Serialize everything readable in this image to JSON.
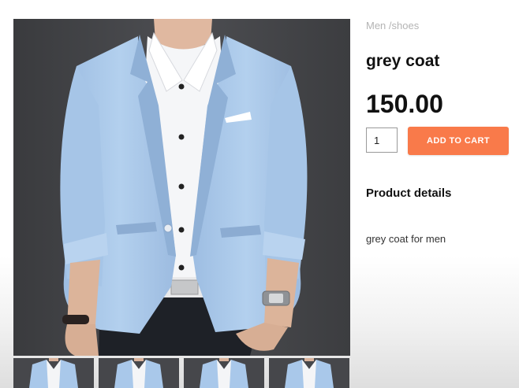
{
  "breadcrumb": "Men /shoes",
  "product": {
    "title": "grey coat",
    "price": "150.00",
    "quantity": "1",
    "add_to_cart_label": "ADD TO CART",
    "details_heading": "Product details",
    "description": "grey coat for men",
    "image_alt": "light blue blazer with white shirt"
  },
  "thumbnails": [
    {
      "alt": "thumbnail 1"
    },
    {
      "alt": "thumbnail 2"
    },
    {
      "alt": "thumbnail 3"
    },
    {
      "alt": "thumbnail 4"
    }
  ],
  "colors": {
    "button": "#f97a4a",
    "photo_background": "#45464a",
    "blazer": "#a9c8ea"
  }
}
